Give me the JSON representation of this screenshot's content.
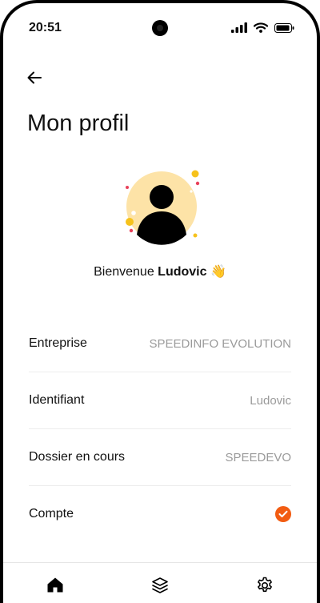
{
  "status_bar": {
    "time": "20:51",
    "icons": [
      "signal-icon",
      "wifi-icon",
      "battery-icon"
    ]
  },
  "header": {
    "back_icon": "arrow-left-icon",
    "title": "Mon profil"
  },
  "profile": {
    "avatar_icon": "user-avatar-icon",
    "welcome_text": "Bienvenue",
    "user_name": "Ludovic",
    "emoji": "👋"
  },
  "details": [
    {
      "label": "Entreprise",
      "value": "SPEEDINFO EVOLUTION"
    },
    {
      "label": "Identifiant",
      "value": "Ludovic"
    },
    {
      "label": "Dossier en cours",
      "value": "SPEEDEVO"
    },
    {
      "label": "Compte",
      "value": "",
      "status_icon": "check-circle-icon"
    }
  ],
  "tab_bar": {
    "items": [
      "home-icon",
      "layers-icon",
      "settings-icon"
    ]
  },
  "colors": {
    "accent": "#f25c12",
    "avatar_bg": "#fde3a7",
    "confetti_yellow": "#f6c21c",
    "confetti_red": "#e8415a",
    "muted_text": "#9a9a9a"
  }
}
